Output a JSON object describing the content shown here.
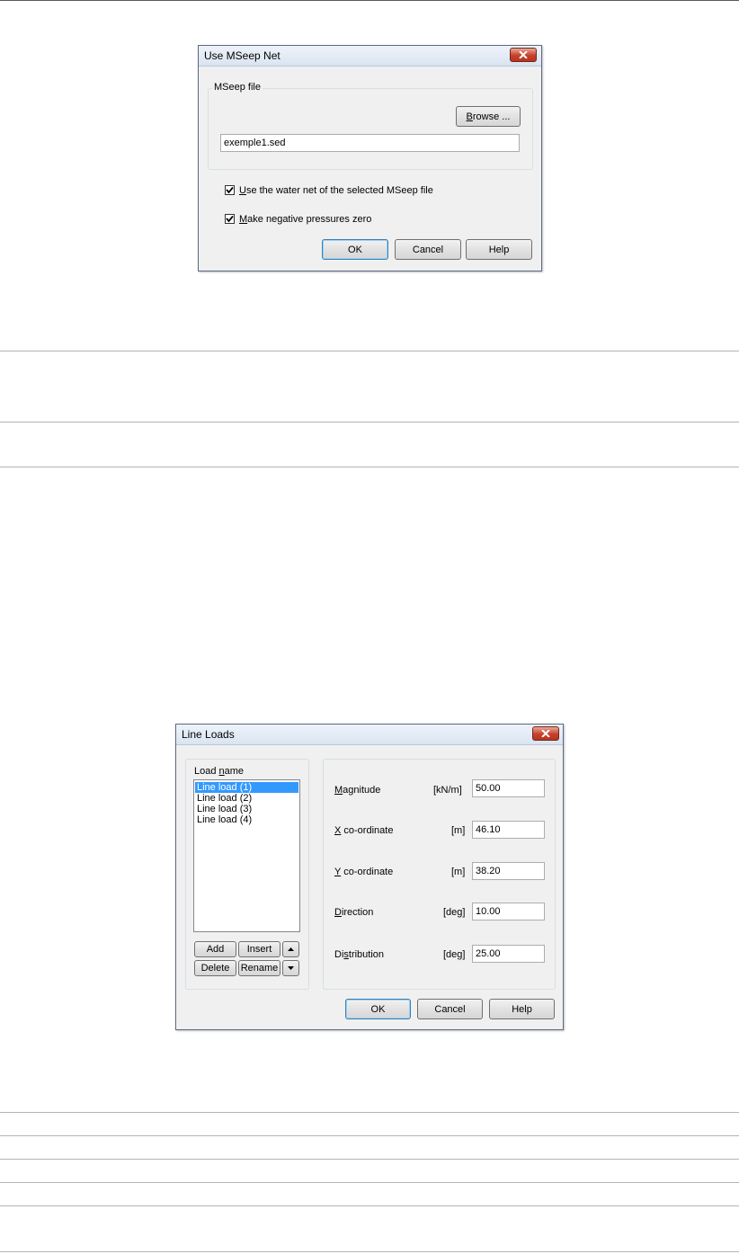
{
  "mseep_dialog": {
    "title": "Use MSeep Net",
    "group_label": "MSeep file",
    "browse_label": "Browse ...",
    "browse_mnemonic": "B",
    "browse_rest": "rowse ...",
    "file_value": "exemple1.sed",
    "checkbox1_mnemonic": "U",
    "checkbox1_rest": "se the water net of the selected MSeep file",
    "checkbox1_label": "Use the water net of the selected MSeep file",
    "checkbox1_checked": true,
    "checkbox2_mnemonic": "M",
    "checkbox2_rest": "ake negative pressures zero",
    "checkbox2_label": "Make negative pressures zero",
    "checkbox2_checked": true,
    "ok_label": "OK",
    "cancel_label": "Cancel",
    "help_label": "Help"
  },
  "lineloads_dialog": {
    "title": "Line Loads",
    "list_label_pre": "Load ",
    "list_label_mnemonic": "n",
    "list_label_post": "ame",
    "list_label": "Load name",
    "items": [
      "Line load (1)",
      "Line load (2)",
      "Line load (3)",
      "Line load (4)"
    ],
    "selected_index": 0,
    "add_label": "Add",
    "insert_label": "Insert",
    "delete_label": "Delete",
    "rename_label": "Rename",
    "fields": [
      {
        "mnemonic": "M",
        "rest": "agnitude",
        "label": "Magnitude",
        "unit": "[kN/m]",
        "value": "50.00"
      },
      {
        "mnemonic": "X",
        "rest": " co-ordinate",
        "label": "X co-ordinate",
        "unit": "[m]",
        "value": "46.10"
      },
      {
        "mnemonic": "Y",
        "rest": " co-ordinate",
        "label": "Y co-ordinate",
        "unit": "[m]",
        "value": "38.20"
      },
      {
        "mnemonic": "D",
        "rest": "irection",
        "label": "Direction",
        "unit": "[deg]",
        "value": "10.00"
      },
      {
        "pre": "Di",
        "mnemonic": "s",
        "rest": "tribution",
        "label": "Distribution",
        "unit": "[deg]",
        "value": "25.00"
      }
    ],
    "ok_label": "OK",
    "cancel_label": "Cancel",
    "help_label": "Help"
  }
}
